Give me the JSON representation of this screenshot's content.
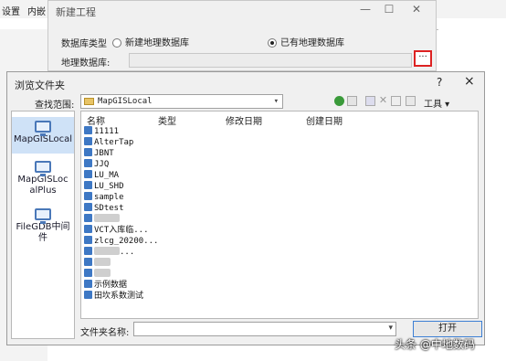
{
  "background_app": {
    "toolbar_items": [
      "设置",
      "内嵌"
    ]
  },
  "new_project_dialog": {
    "title": "新建工程",
    "db_type_label": "数据库类型",
    "option_new": "新建地理数据库",
    "option_existing": "已有地理数据库",
    "selected_option": "已有地理数据库",
    "db_label": "地理数据库:",
    "browse_button": "···"
  },
  "browse_dialog": {
    "title": "浏览文件夹",
    "help": "?",
    "close": "×",
    "look_in_label": "查找范围:",
    "look_in_value": "MapGISLocal",
    "tools_label": "工具 ▾",
    "places": [
      "MapGISLocal",
      "MapGISLocalPlus",
      "FileGDB中间件"
    ],
    "selected_place": "MapGISLocal",
    "columns": [
      "名称",
      "类型",
      "修改日期",
      "创建日期"
    ],
    "items": [
      "11111",
      "AlterTap",
      "JBNT",
      "JJQ",
      "LU_MA",
      "LU_SHD",
      "sample",
      "SDtest",
      "",
      "VCT入库临...",
      "zlcg_20200...",
      "...",
      "",
      "",
      "示例数据",
      "田坎系数测试"
    ],
    "filename_label": "文件夹名称:",
    "filename_value": "",
    "open_button": "打开"
  },
  "watermark": "头条 @中地数码"
}
